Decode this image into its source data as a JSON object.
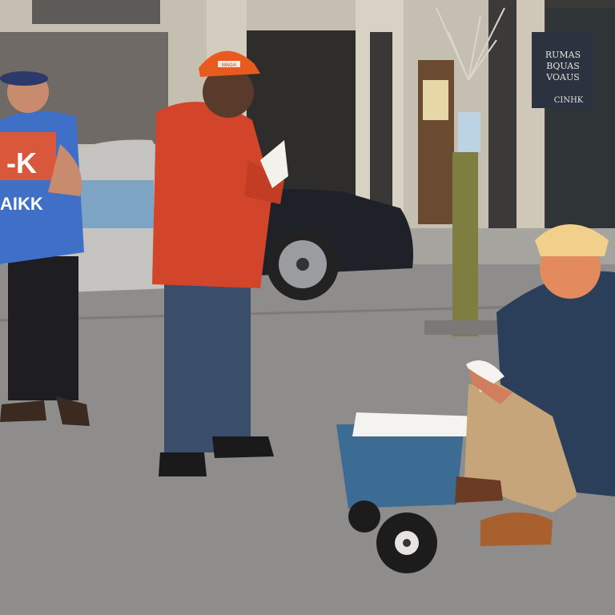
{
  "scene": {
    "kind": "street-photo",
    "colors": {
      "sky_building": "#c9c2b4",
      "asphalt": "#8c8c8a",
      "sidewalk": "#a9a7a1",
      "red_jacket": "#d2452a",
      "blue_shirt": "#3f6fc6",
      "navy_jacket": "#2c3f5a",
      "khaki_pants": "#c7a57a",
      "cart_blue": "#3c6b93"
    }
  },
  "shirt_print": {
    "line1": "-K",
    "line2": "AIKK"
  },
  "store_sign": {
    "line1": "RUMAS",
    "line2": "BQUAS",
    "line3": "VOAUS",
    "line4": "CINHK"
  },
  "cap_badge": "MAGA"
}
